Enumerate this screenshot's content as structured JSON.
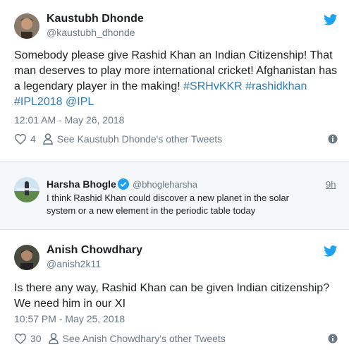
{
  "tweet1": {
    "name": "Kaustubh Dhonde",
    "handle": "@kaustubh_dhonde",
    "text_plain": "Somebody please give Rashid Khan an Indian Citizenship! That man deserves to play more international cricket! Afghanistan has a legendary player in the making! ",
    "links": [
      "#SRHvKKR",
      "#rashidkhan",
      "#IPL2018",
      "@IPL"
    ],
    "timestamp": "12:01 AM - May 26, 2018",
    "like_count": "4",
    "other_tweets": "See Kaustubh Dhonde's other Tweets"
  },
  "quoted": {
    "name": "Harsha Bhogle",
    "handle": "@bhogleharsha",
    "time": "9h",
    "text": "I think Rashid Khan could discover a new planet in the solar system or a new element in the periodic table today"
  },
  "tweet2": {
    "name": "Anish Chowdhary",
    "handle": "@anish2k11",
    "text": "Is there any way, Rashid Khan can be given Indian citizenship? We need him in our XI",
    "timestamp": "10:57 PM - May 25, 2018",
    "like_count": "30",
    "other_tweets": "See Anish Chowdhary's other Tweets"
  },
  "colors": {
    "link": "#2b7bb9",
    "twitter_blue": "#1da1f2",
    "secondary_text": "#697882"
  },
  "icons": [
    "twitter-bird-icon",
    "heart-icon",
    "person-icon",
    "info-icon",
    "verified-badge-icon"
  ]
}
